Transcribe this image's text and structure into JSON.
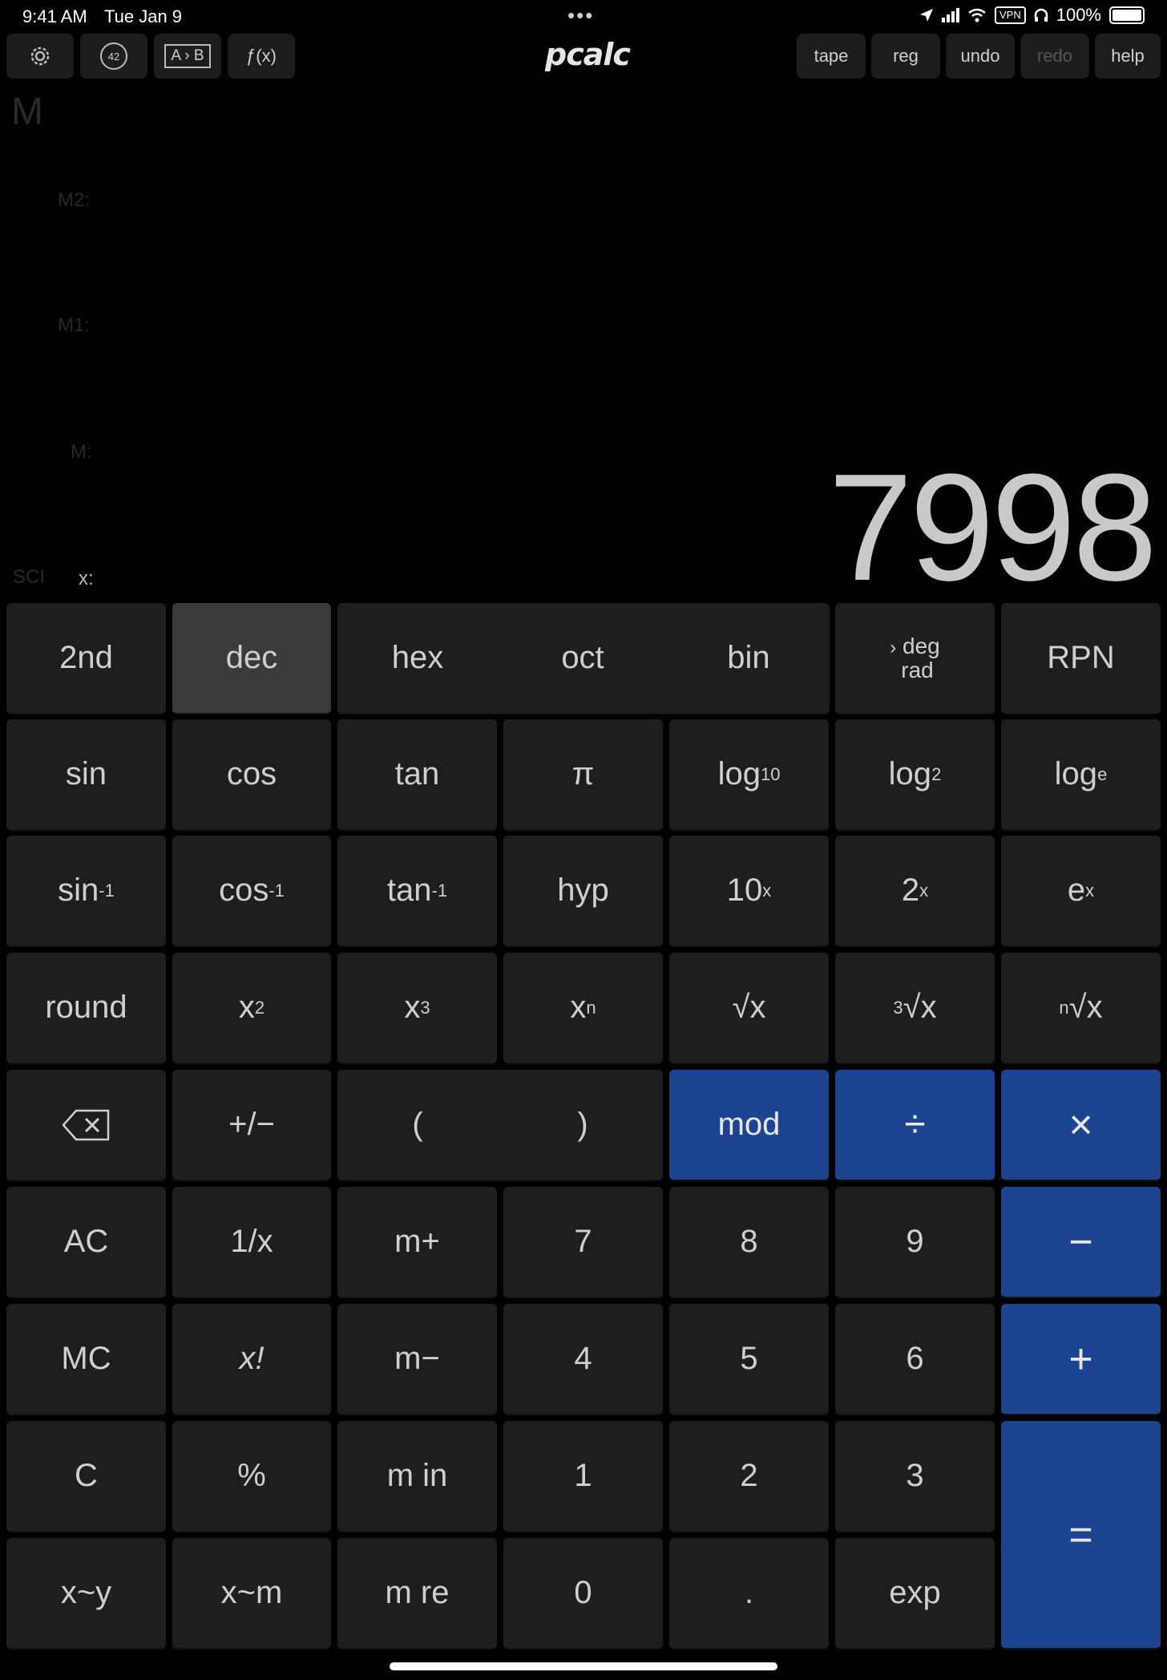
{
  "status_bar": {
    "time": "9:41 AM",
    "date": "Tue Jan 9",
    "battery": "100%",
    "vpn": "VPN"
  },
  "toolbar": {
    "settings_icon": "gear-icon",
    "constants_label": "42",
    "convert_label": "A › B",
    "functions_label": "ƒ(x)",
    "logo": "pcalc",
    "tape": "tape",
    "reg": "reg",
    "undo": "undo",
    "redo": "redo"
  },
  "help_label": "help",
  "display": {
    "memory_indicator": "M",
    "m2_label": "M2:",
    "m1_label": "M1:",
    "m_label": "M:",
    "mode": "SCI",
    "x_label": "x:",
    "x_value": "7998"
  },
  "keys": {
    "second": "2nd",
    "dec": "dec",
    "hex": "hex",
    "oct": "oct",
    "bin": "bin",
    "deg": "deg",
    "rad": "rad",
    "rpn": "RPN",
    "sin": "sin",
    "cos": "cos",
    "tan": "tan",
    "pi": "π",
    "log": "log",
    "log10_sub": "10",
    "log2_sub": "2",
    "loge_sub": "e",
    "asin": "sin",
    "acos": "cos",
    "atan": "tan",
    "inv_sup": "-1",
    "hyp": "hyp",
    "ten": "10",
    "two": "2",
    "e": "e",
    "x_sup": "x",
    "round": "round",
    "x": "x",
    "sq_sup": "2",
    "cube_sup": "3",
    "n_sup": "n",
    "sqrt": "√x",
    "cbrt_index": "3",
    "nrt_index": "n",
    "root_body": "√x",
    "plus_minus": "+/−",
    "lparen": "(",
    "rparen": ")",
    "mod": "mod",
    "divide": "÷",
    "multiply": "×",
    "ac": "AC",
    "reciprocal": "1/x",
    "m_plus": "m+",
    "seven": "7",
    "eight": "8",
    "nine": "9",
    "minus": "−",
    "mc": "MC",
    "factorial": "x!",
    "m_minus": "m−",
    "four": "4",
    "five": "5",
    "six": "6",
    "plus": "+",
    "c": "C",
    "percent": "%",
    "m_in": "m in",
    "one": "1",
    "two_digit": "2",
    "three": "3",
    "equals": "=",
    "swap_xy": "x~y",
    "swap_xm": "x~m",
    "m_re": "m re",
    "zero": "0",
    "point": ".",
    "exp": "exp"
  },
  "colors": {
    "background": "#000000",
    "key": "#1e1e1e",
    "key_selected": "#3a3a3a",
    "operator": "#1c4491"
  }
}
